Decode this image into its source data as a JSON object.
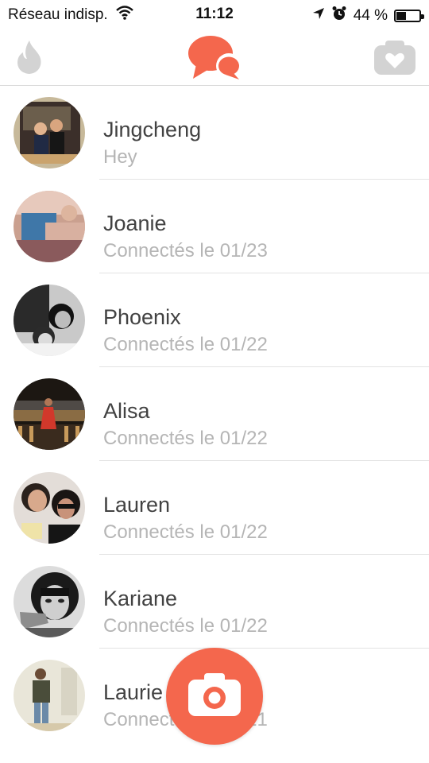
{
  "status_bar": {
    "carrier": "Réseau indisp.",
    "time": "11:12",
    "battery_percent": "44 %",
    "battery_level": 0.44,
    "icons": [
      "wifi-icon",
      "location-arrow-icon",
      "alarm-icon",
      "battery-icon"
    ]
  },
  "nav": {
    "left_icon": "flame-icon",
    "center_icon": "chat-bubbles-icon",
    "right_icon": "heart-camera-icon",
    "accent_color": "#f4674d",
    "inactive_color": "#d3d3d3"
  },
  "conversations": [
    {
      "name": "Jingcheng",
      "subtitle": "Hey"
    },
    {
      "name": "Joanie",
      "subtitle": "Connectés le 01/23"
    },
    {
      "name": "Phoenix",
      "subtitle": "Connectés le 01/22"
    },
    {
      "name": "Alisa",
      "subtitle": "Connectés le 01/22"
    },
    {
      "name": "Lauren",
      "subtitle": "Connectés le 01/22"
    },
    {
      "name": "Kariane",
      "subtitle": "Connectés le 01/22"
    },
    {
      "name": "Laurie",
      "subtitle": "Connectés le 01/21"
    }
  ],
  "fab": {
    "icon": "camera-icon"
  }
}
